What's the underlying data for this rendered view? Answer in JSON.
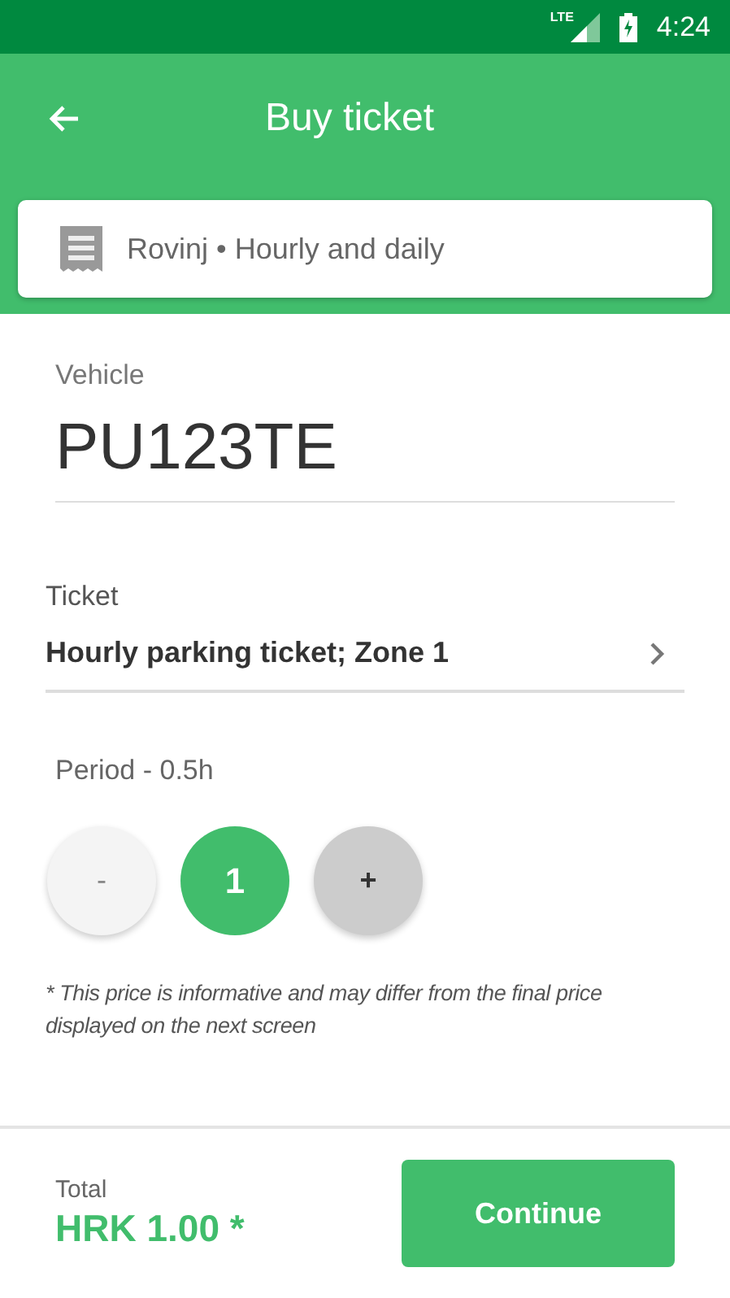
{
  "status_bar": {
    "network": "LTE",
    "time": "4:24"
  },
  "app_bar": {
    "title": "Buy ticket"
  },
  "zone_card": {
    "text": "Rovinj • Hourly and daily"
  },
  "vehicle": {
    "label": "Vehicle",
    "value": "PU123TE"
  },
  "ticket": {
    "label": "Ticket",
    "value": "Hourly parking ticket; Zone 1"
  },
  "period": {
    "label": "Period - 0.5h",
    "controls": [
      {
        "kind": "decrement",
        "text": "-",
        "disabled": true
      },
      {
        "kind": "count",
        "text": "1"
      },
      {
        "kind": "increment",
        "text": "+",
        "disabled": false
      }
    ]
  },
  "note": "* This price is informative and may differ from the final price displayed on the next screen",
  "footer": {
    "total_label": "Total",
    "total": "HRK 1.00 *",
    "button": "Continue"
  }
}
